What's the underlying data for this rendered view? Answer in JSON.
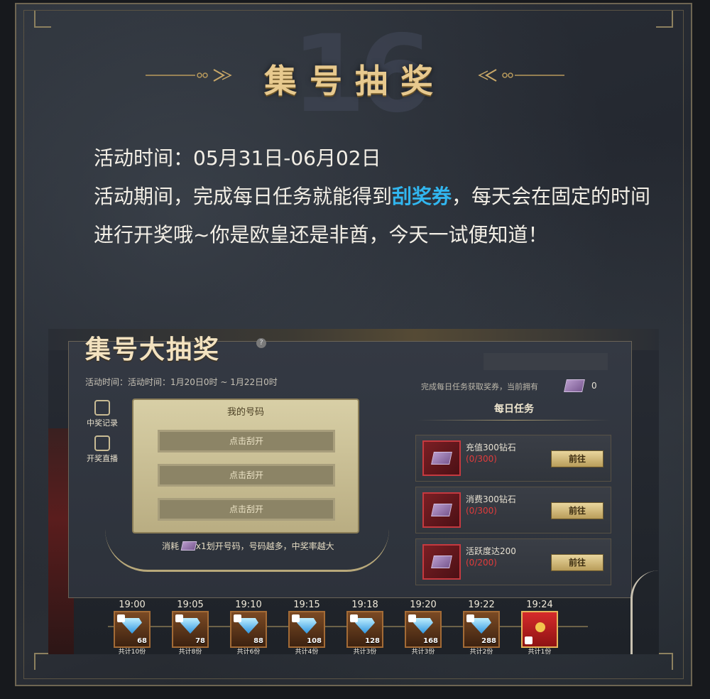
{
  "header": {
    "number": "16",
    "title": "集号抽奖"
  },
  "intro": {
    "time_line": "活动时间：05月31日-06月02日",
    "desc_before": "活动期间，完成每日任务就能得到",
    "desc_highlight": "刮奖券",
    "desc_after": "，每天会在固定的时间进行开奖哦~你是欧皇还是非酋，今天一试便知道！"
  },
  "colors": {
    "title_gold": "#e7c98e",
    "highlight_blue": "#31b6ef",
    "progress_red": "#e23b3b",
    "button_gold": "#e9d69e"
  },
  "game": {
    "title": "集号大抽奖",
    "help_label": "?",
    "time_text": "活动时间：活动时间：1月20日0时 ~ 1月22日0时",
    "task_hint": "完成每日任务获取奖券，当前拥有",
    "ticket_count": "0",
    "side_buttons": [
      {
        "label": "中奖记录",
        "icon": "trophy-icon"
      },
      {
        "label": "开奖直播",
        "icon": "tv-icon"
      }
    ],
    "ticket_header": "我的号码",
    "scratch_label": "点击刮开",
    "consume_prefix": "消耗",
    "consume_suffix": "x1划开号码，号码越多，中奖率越大",
    "daily_title": "每日任务",
    "tasks": [
      {
        "name": "充值300钻石",
        "progress": "(0/300)",
        "button": "前往"
      },
      {
        "name": "消费300钻石",
        "progress": "(0/300)",
        "button": "前往"
      },
      {
        "name": "活跃度达200",
        "progress": "(0/200)",
        "button": "前往"
      }
    ],
    "draws": [
      {
        "time": "19:00",
        "gems": "68",
        "shares": "共计10份"
      },
      {
        "time": "19:05",
        "gems": "78",
        "shares": "共计8份"
      },
      {
        "time": "19:10",
        "gems": "88",
        "shares": "共计6份"
      },
      {
        "time": "19:15",
        "gems": "108",
        "shares": "共计4份"
      },
      {
        "time": "19:18",
        "gems": "128",
        "shares": "共计3份"
      },
      {
        "time": "19:20",
        "gems": "168",
        "shares": "共计3份"
      },
      {
        "time": "19:22",
        "gems": "288",
        "shares": "共计2份"
      },
      {
        "time": "19:24",
        "gems": "",
        "shares": "共计1份"
      }
    ]
  }
}
